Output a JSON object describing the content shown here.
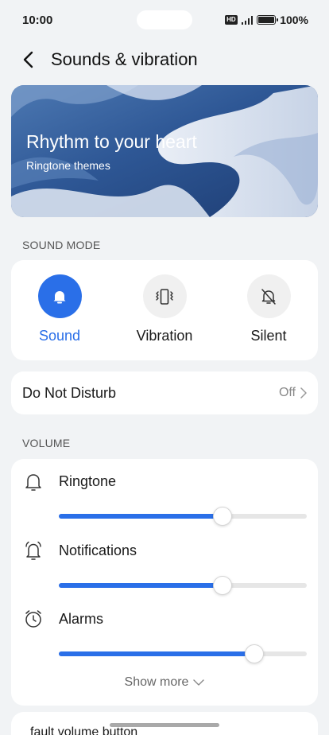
{
  "status": {
    "time": "10:00",
    "hd": "HD",
    "battery": "100%"
  },
  "header": {
    "title": "Sounds & vibration"
  },
  "banner": {
    "title": "Rhythm to your heart",
    "subtitle": "Ringtone themes"
  },
  "sound_mode": {
    "section_label": "SOUND MODE",
    "modes": [
      {
        "label": "Sound",
        "icon": "bell-icon",
        "selected": true
      },
      {
        "label": "Vibration",
        "icon": "vibration-icon",
        "selected": false
      },
      {
        "label": "Silent",
        "icon": "bell-off-icon",
        "selected": false
      }
    ]
  },
  "dnd": {
    "label": "Do Not Disturb",
    "value": "Off"
  },
  "volume": {
    "section_label": "VOLUME",
    "items": [
      {
        "label": "Ringtone",
        "icon": "bell-icon",
        "level": 0.66
      },
      {
        "label": "Notifications",
        "icon": "notification-bell-icon",
        "level": 0.66
      },
      {
        "label": "Alarms",
        "icon": "alarm-clock-icon",
        "level": 0.79
      }
    ],
    "show_more": "Show more"
  },
  "bottom": {
    "text": "fault volume button"
  },
  "colors": {
    "accent": "#2a6fe8",
    "background": "#f1f3f5",
    "card": "#ffffff"
  }
}
